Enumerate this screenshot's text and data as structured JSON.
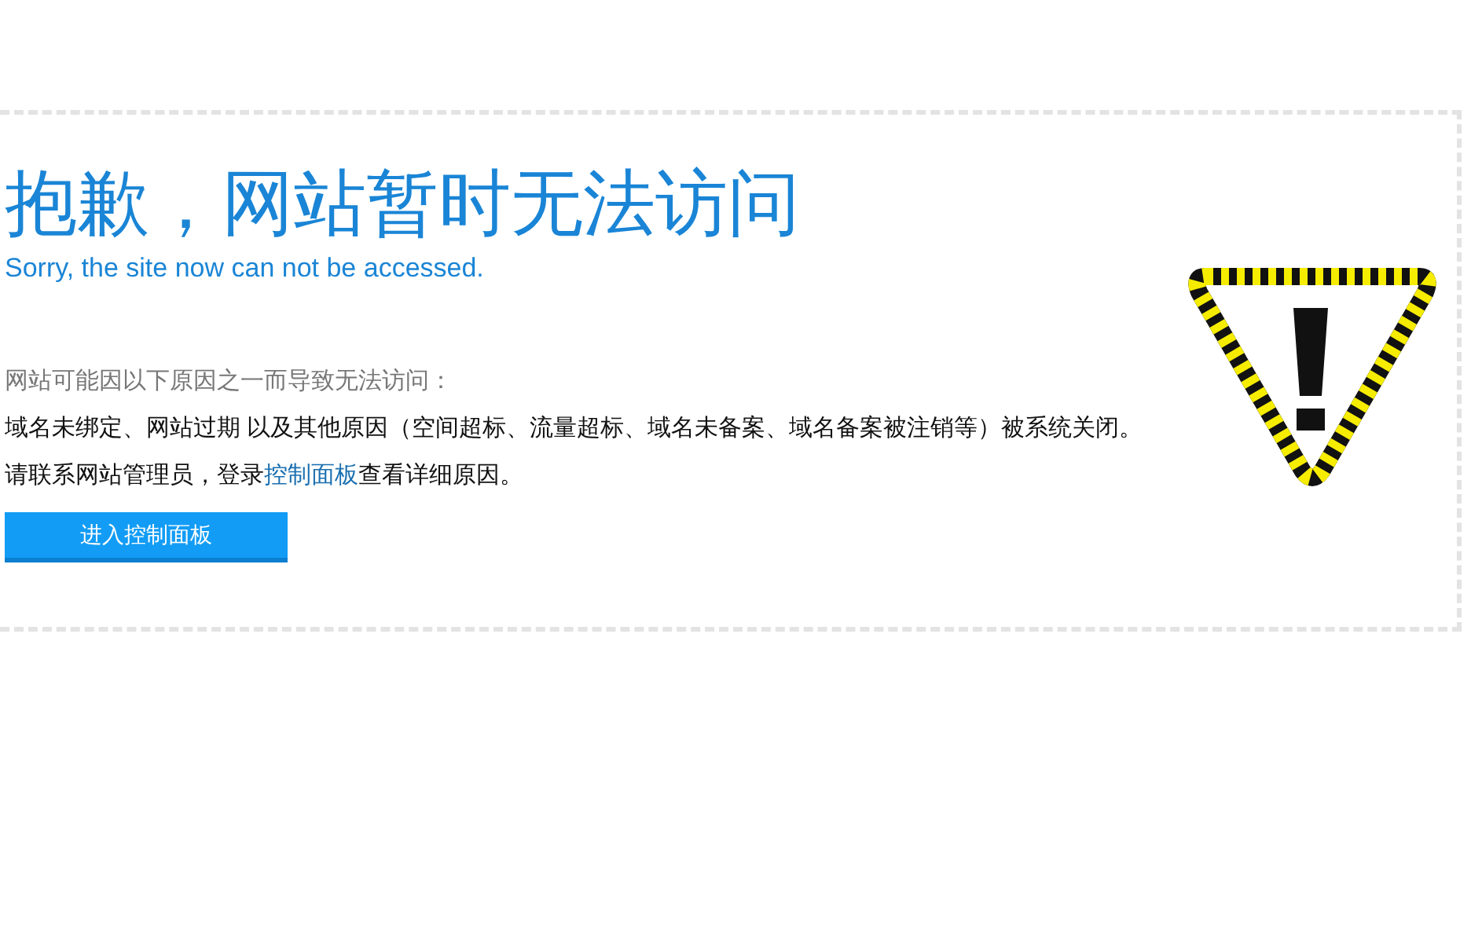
{
  "title": "抱歉，网站暂时无法访问",
  "subtitle": "Sorry, the site now can not be accessed.",
  "reasons_intro": "网站可能因以下原因之一而导致无法访问：",
  "reasons": "域名未绑定、网站过期 以及其他原因（空间超标、流量超标、域名未备案、域名备案被注销等）被系统关闭。",
  "contact": {
    "before": "请联系网站管理员，登录",
    "link": "控制面板",
    "after": "查看详细原因。"
  },
  "button": "进入控制面板"
}
